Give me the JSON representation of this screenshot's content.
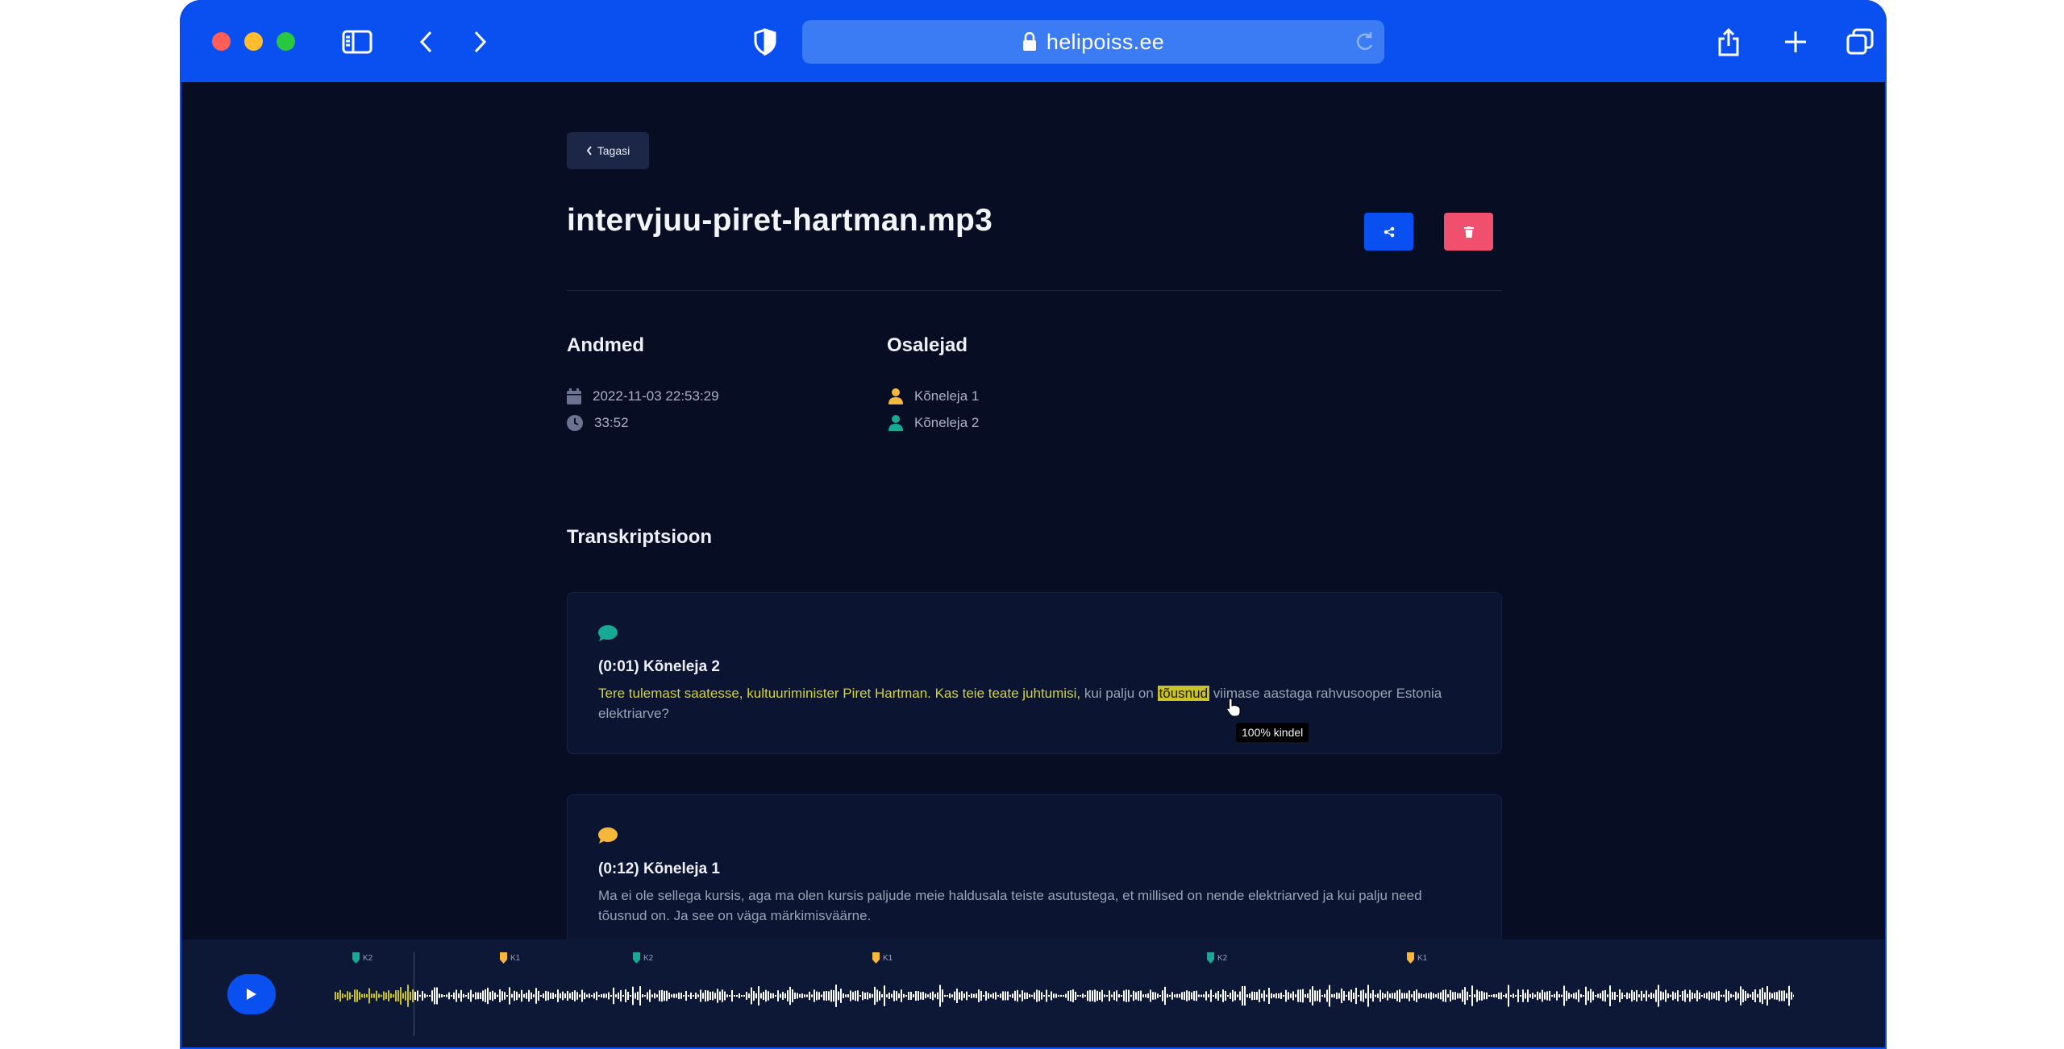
{
  "browser": {
    "url": "helipoiss.ee"
  },
  "page": {
    "back_label": "Tagasi",
    "file_title": "intervjuu-piret-hartman.mp3",
    "details_heading": "Andmed",
    "participants_heading": "Osalejad",
    "date": "2022-11-03 22:53:29",
    "duration": "33:52",
    "participants": [
      {
        "name": "Kõneleja 1",
        "color": "#f6b73c"
      },
      {
        "name": "Kõneleja 2",
        "color": "#17a994"
      }
    ],
    "transcription_heading": "Transkriptsioon"
  },
  "segments": [
    {
      "header": "(0:01) Kõneleja 2",
      "color": "#17a994",
      "text_played": "Tere tulemast saatesse, kultuuriminister Piret Hartman. Kas teie teate juhtumisi,",
      "text_before_hover": " kui palju on ",
      "hover_word": "tõusnud",
      "text_after_hover": " viimase aastaga rahvusooper Estonia elektriarve?",
      "tooltip": "100% kindel"
    },
    {
      "header": "(0:12) Kõneleja 1",
      "color": "#f6b73c",
      "text": "Ma ei ole sellega kursis, aga ma olen kursis paljude meie haldusala teiste asutustega, et millised on nende elektriarved ja kui palju need tõusnud on. Ja see on väga märkimisväärne."
    }
  ],
  "player": {
    "markers": [
      {
        "label": "K2",
        "color": "#17a994"
      },
      {
        "label": "K1",
        "color": "#f6b73c"
      },
      {
        "label": "K2",
        "color": "#17a994"
      },
      {
        "label": "K1",
        "color": "#f6b73c"
      },
      {
        "label": "K2",
        "color": "#17a994"
      },
      {
        "label": "K1",
        "color": "#f6b73c"
      }
    ],
    "played_color": "#c9c22b",
    "wave_color": "#ffffff"
  }
}
